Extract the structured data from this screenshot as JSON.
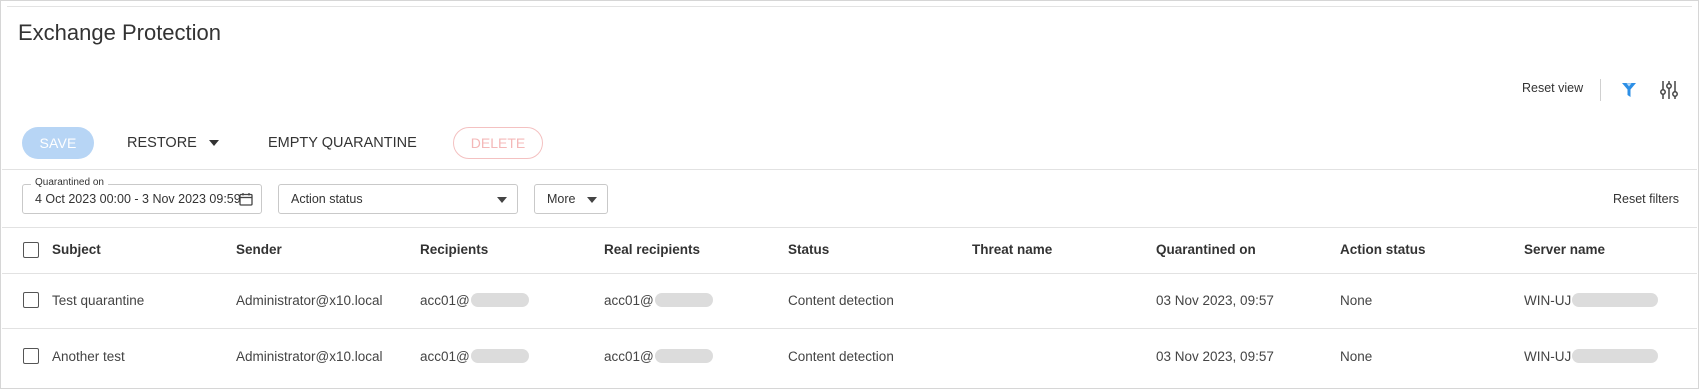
{
  "page": {
    "title": "Exchange Protection"
  },
  "view_tools": {
    "reset_view": "Reset view",
    "filter_icon": "funnel-icon",
    "columns_icon": "sliders-icon",
    "filter_icon_color": "#2d8fe6"
  },
  "toolbar": {
    "save": "SAVE",
    "restore": "RESTORE",
    "empty_quarantine": "EMPTY QUARANTINE",
    "delete": "DELETE"
  },
  "filters": {
    "quarantined_on_label": "Quarantined on",
    "quarantined_on_value": "4 Oct 2023 00:00 - 3 Nov 2023 09:59",
    "action_status": "Action status",
    "more": "More",
    "reset_filters": "Reset filters"
  },
  "table": {
    "columns": [
      "Subject",
      "Sender",
      "Recipients",
      "Real recipients",
      "Status",
      "Threat name",
      "Quarantined on",
      "Action status",
      "Server name"
    ],
    "rows": [
      {
        "subject": "Test quarantine",
        "sender": "Administrator@x10.local",
        "recipients": "acc01@",
        "real_recipients": "acc01@",
        "status": "Content detection",
        "threat_name": "",
        "quarantined_on": "03 Nov 2023, 09:57",
        "action_status": "None",
        "server_name": "WIN-UJ"
      },
      {
        "subject": "Another test",
        "sender": "Administrator@x10.local",
        "recipients": "acc01@",
        "real_recipients": "acc01@",
        "status": "Content detection",
        "threat_name": "",
        "quarantined_on": "03 Nov 2023, 09:57",
        "action_status": "None",
        "server_name": "WIN-UJ"
      }
    ]
  },
  "colors": {
    "accent": "#2d8fe6",
    "save_disabled_bg": "#b7d5f5",
    "delete_disabled": "#f4b8b8"
  }
}
